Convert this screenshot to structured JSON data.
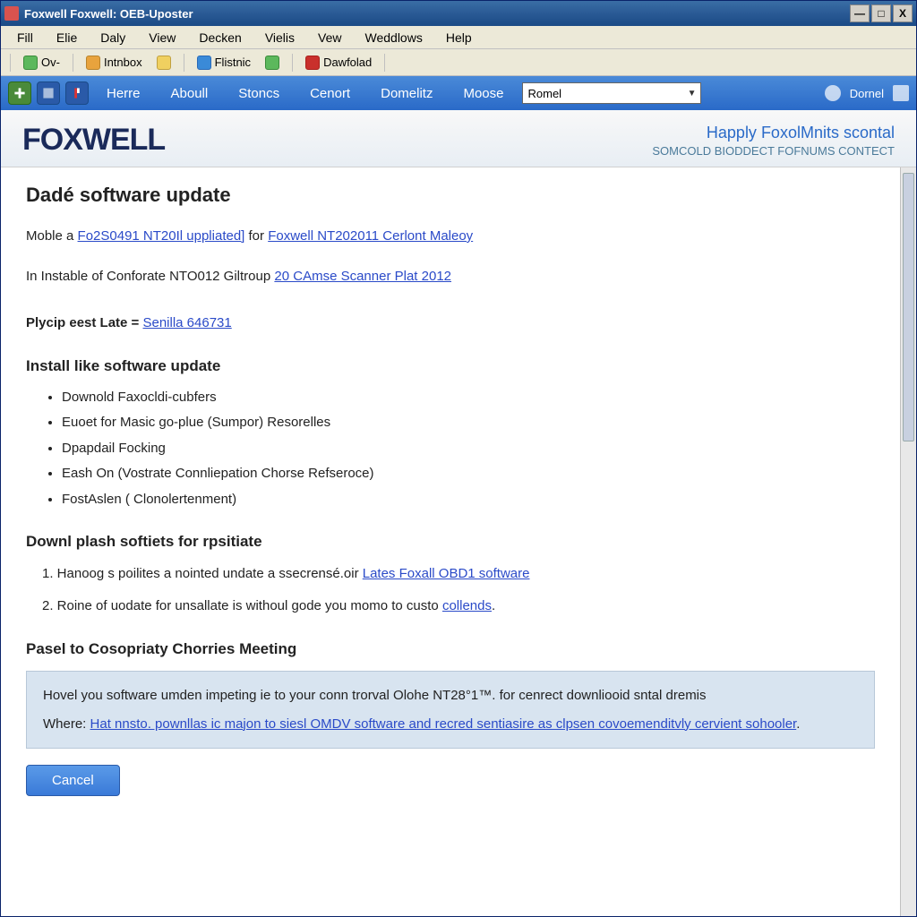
{
  "window": {
    "title": "Foxwell Foxwell: OEB-Uposter"
  },
  "menubar": [
    "Fill",
    "Elie",
    "Daly",
    "View",
    "Decken",
    "Vielis",
    "Vew",
    "Weddlows",
    "Help"
  ],
  "toolbar": {
    "ov": "Ov-",
    "intnbox": "Intnbox",
    "flistnic": "Flistnic",
    "dawfolad": "Dawfolad"
  },
  "navbar": {
    "links": [
      "Herre",
      "Aboull",
      "Stoncs",
      "Cenort",
      "Domelitz",
      "Moose"
    ],
    "select_value": "Romel",
    "right_label": "Dornel"
  },
  "header": {
    "brand": "FOXWELL",
    "top": "Happly FoxolMnits scontal",
    "bottom": "SOMCOLD BIODDECT FOFNUMS CONTECT"
  },
  "content": {
    "h1": "Dadé software update",
    "p1_a": "Moble a ",
    "p1_link1": "Fo2S0491 NT20Il uppliated]",
    "p1_b": " for ",
    "p1_link2": "Foxwell NT202011 Cerlont Maleoy",
    "p2_a": "In Instable of Conforate NTO012 Giltroup ",
    "p2_link": "20 CAmse Scanner Plat 2012",
    "p3_label": "Plycip eest Late = ",
    "p3_link": "Senilla 646731",
    "h2a": "Install like software update",
    "bullets": [
      "Downold Faxocldi-cubfers",
      "Euoet for Masic go-plue (Sumpor) Resorelles",
      "Dpapdail Focking",
      "Eash On (Vostrate Connliepation Chorse Refseroce)",
      "FostAslen ( Clonolertenment)"
    ],
    "h2b": "Downl plash softiets for rpsitiate",
    "ol1_a": "1. Hanoog s poilites a nointed undate a ssecrensé.oir ",
    "ol1_link": "Lates Foxall OBD1 software",
    "ol2_a": "2. Roine of uodate for unsallate is withoul gode you momo to custo ",
    "ol2_link": "collends",
    "ol2_b": ".",
    "h2c": "Pasel to Cosopriaty Chorries Meeting",
    "note_a": "Hovel you software umden impeting ie to your conn trorval Olohe  NT28°1™. for cenrect downliooid sntal dremis",
    "note_b": "Where: ",
    "note_link": "Hat nnsto. pownllas ic majon to siesl OMDV software and recred sentiasire as clpsen covoemenditvly cervient sohooler",
    "note_c": ".",
    "cancel": "Cancel"
  }
}
